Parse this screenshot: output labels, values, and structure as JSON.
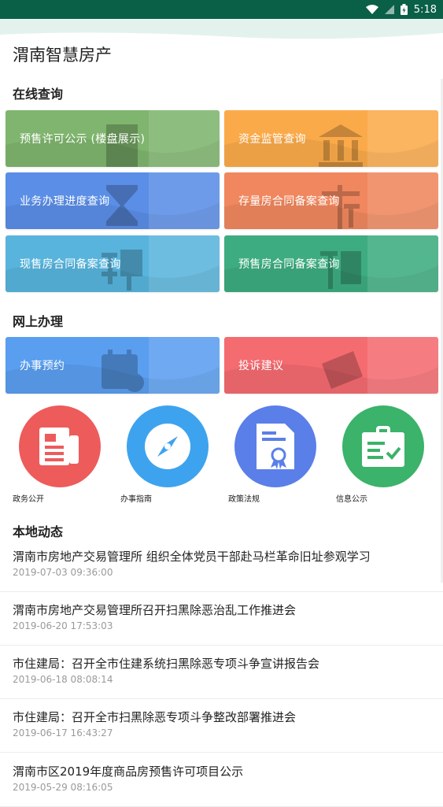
{
  "status_bar": {
    "time": "5:18",
    "icons": [
      "wifi-icon",
      "signal-icon",
      "battery-icon"
    ]
  },
  "app": {
    "title": "渭南智慧房产"
  },
  "online_query": {
    "title": "在线查询",
    "tiles": [
      {
        "label": "预售许可公示 (楼盘展示)",
        "icon": "building-icon",
        "color": "#7fb56e"
      },
      {
        "label": "资金监管查询",
        "icon": "bank-icon",
        "color": "#fbaa4a"
      },
      {
        "label": "业务办理进度查询",
        "icon": "hourglass-icon",
        "color": "#5b8ee6"
      },
      {
        "label": "存量房合同备案查询",
        "icon": "cun-character-icon",
        "color": "#f0875e"
      },
      {
        "label": "现售房合同备案查询",
        "icon": "xian-character-icon",
        "color": "#58b4dc"
      },
      {
        "label": "预售房合同备案查询",
        "icon": "yu-character-icon",
        "color": "#3dac80"
      }
    ]
  },
  "online_handle": {
    "title": "网上办理",
    "tiles": [
      {
        "label": "办事预约",
        "icon": "calendar-icon",
        "color": "#5a9ef0"
      },
      {
        "label": "投诉建议",
        "icon": "complaint-icon",
        "color": "#f46b70"
      }
    ]
  },
  "quick_links": [
    {
      "label": "政务公开",
      "icon": "newspaper-icon",
      "color": "#ee5b5b"
    },
    {
      "label": "办事指南",
      "icon": "compass-icon",
      "color": "#3ea3ee"
    },
    {
      "label": "政策法规",
      "icon": "certificate-icon",
      "color": "#5a7fe8"
    },
    {
      "label": "信息公示",
      "icon": "clipboard-check-icon",
      "color": "#3bb36a"
    }
  ],
  "local_news": {
    "title": "本地动态",
    "items": [
      {
        "title": "渭南市房地产交易管理所 组织全体党员干部赴马栏革命旧址参观学习",
        "date": "2019-07-03 09:36:00"
      },
      {
        "title": "渭南市房地产交易管理所召开扫黑除恶治乱工作推进会",
        "date": "2019-06-20 17:53:03"
      },
      {
        "title": "市住建局：召开全市住建系统扫黑除恶专项斗争宣讲报告会",
        "date": "2019-06-18 08:08:14"
      },
      {
        "title": "市住建局：召开全市扫黑除恶专项斗争整改部署推进会",
        "date": "2019-06-17 16:43:27"
      },
      {
        "title": "渭南市区2019年度商品房预售许可项目公示",
        "date": "2019-05-29 08:16:05"
      }
    ]
  }
}
